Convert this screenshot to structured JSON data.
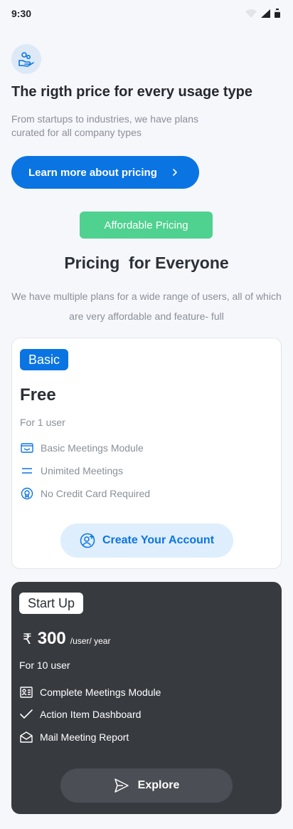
{
  "status_bar": {
    "time": "9:30"
  },
  "hero": {
    "icon": "hand-coins-icon",
    "title": "The rigth price for every usage type",
    "subtitle": "From startups to industries, we have plans curated for all company types",
    "learn_more_label": "Learn more about pricing"
  },
  "section": {
    "badge": "Affordable Pricing",
    "title": "Pricing  for Everyone",
    "subtitle": "We have multiple plans for a wide range of users, all of which are very affordable and feature- full"
  },
  "plans": [
    {
      "badge": "Basic",
      "price": "Free",
      "users": "For 1 user",
      "features": [
        {
          "icon": "mail-icon",
          "label": "Basic Meetings Module"
        },
        {
          "icon": "equals-icon",
          "label": "Unimited Meetings"
        },
        {
          "icon": "badge-icon",
          "label": "No Credit Card Required"
        }
      ],
      "cta_label": "Create Your Account",
      "cta_icon": "add-user-icon"
    },
    {
      "badge": "Start Up",
      "currency": "₹",
      "price": "300",
      "period": "/user/ year",
      "users": "For 10 user",
      "features": [
        {
          "icon": "id-card-icon",
          "label": "Complete Meetings Module"
        },
        {
          "icon": "check-icon",
          "label": "Action Item Dashboard"
        },
        {
          "icon": "open-mail-icon",
          "label": "Mail Meeting Report"
        }
      ],
      "cta_label": "Explore",
      "cta_icon": "send-icon"
    }
  ],
  "colors": {
    "primary": "#0a74e3",
    "success": "#4fd190",
    "dark_card": "#373b40",
    "background": "#f6f7fb"
  }
}
